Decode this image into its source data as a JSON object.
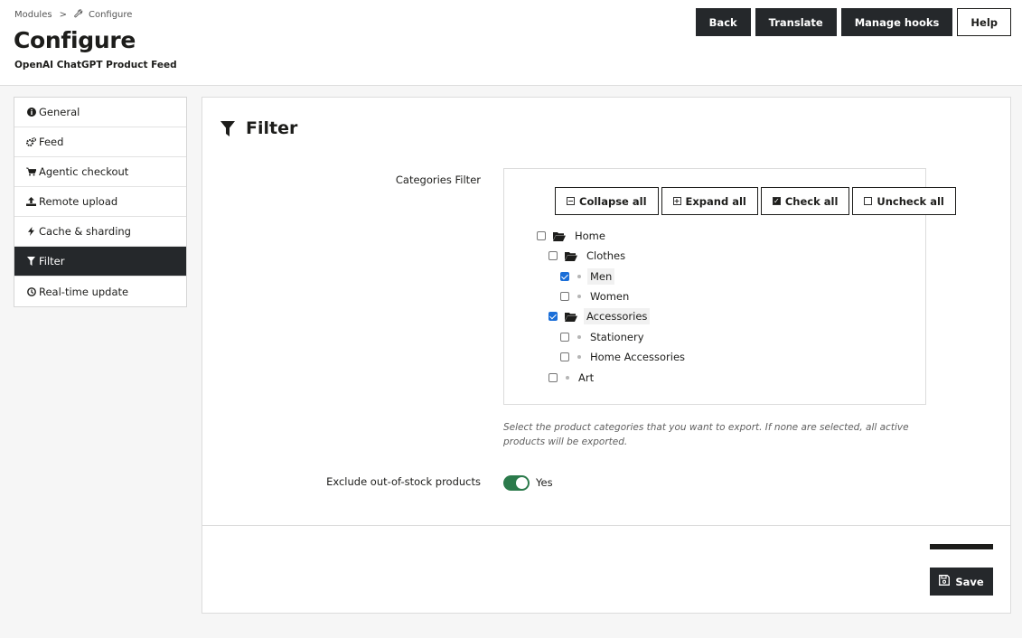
{
  "breadcrumb": {
    "parent": "Modules",
    "separator": ">",
    "current": "Configure"
  },
  "page": {
    "title": "Configure",
    "subtitle": "OpenAI ChatGPT Product Feed"
  },
  "toolbar": {
    "back": "Back",
    "translate": "Translate",
    "manage_hooks": "Manage hooks",
    "help": "Help"
  },
  "sidebar": {
    "items": [
      {
        "label": "General",
        "icon": "info-circle-icon"
      },
      {
        "label": "Feed",
        "icon": "cogs-icon"
      },
      {
        "label": "Agentic checkout",
        "icon": "cart-icon"
      },
      {
        "label": "Remote upload",
        "icon": "upload-icon"
      },
      {
        "label": "Cache & sharding",
        "icon": "bolt-icon"
      },
      {
        "label": "Filter",
        "icon": "filter-icon",
        "active": true
      },
      {
        "label": "Real-time update",
        "icon": "clock-icon"
      }
    ]
  },
  "section": {
    "title": "Filter",
    "icon": "filter-icon"
  },
  "categories_filter": {
    "label": "Categories Filter",
    "actions": {
      "collapse_all": "Collapse all",
      "expand_all": "Expand all",
      "check_all": "Check all",
      "uncheck_all": "Uncheck all"
    },
    "tree": [
      {
        "label": "Home",
        "checked": false,
        "type": "folder"
      },
      {
        "label": "Clothes",
        "checked": false,
        "type": "folder"
      },
      {
        "label": "Men",
        "checked": true,
        "type": "leaf"
      },
      {
        "label": "Women",
        "checked": false,
        "type": "leaf"
      },
      {
        "label": "Accessories",
        "checked": true,
        "type": "folder"
      },
      {
        "label": "Stationery",
        "checked": false,
        "type": "leaf"
      },
      {
        "label": "Home Accessories",
        "checked": false,
        "type": "leaf"
      },
      {
        "label": "Art",
        "checked": false,
        "type": "leaf"
      }
    ],
    "help": "Select the product categories that you want to export. If none are selected, all active products will be exported."
  },
  "exclude_out_of_stock": {
    "label": "Exclude out-of-stock products",
    "value": "Yes",
    "enabled": true
  },
  "save": {
    "label": "Save"
  },
  "colors": {
    "dark": "#25282b",
    "accent_toggle": "#2b7a4b",
    "checkbox": "#1a6ed8"
  }
}
